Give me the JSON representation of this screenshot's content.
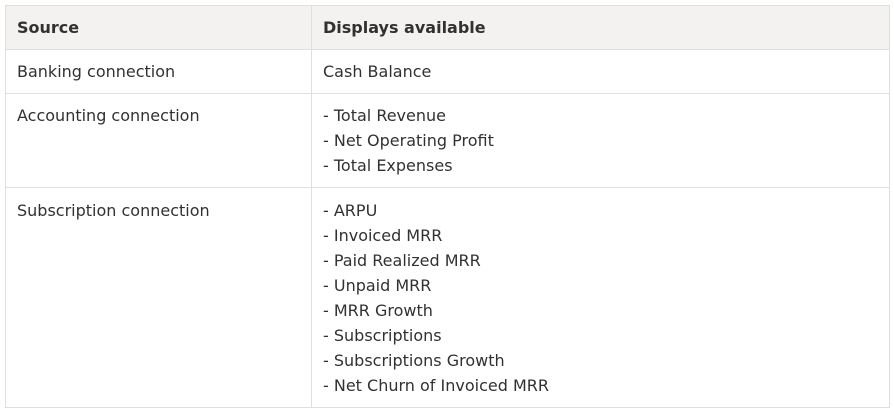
{
  "table": {
    "headers": [
      "Source",
      "Displays available"
    ],
    "rows": [
      {
        "source": "Banking connection",
        "displays": [
          "Cash Balance"
        ]
      },
      {
        "source": "Accounting connection",
        "displays": [
          "- Total Revenue",
          "- Net Operating Profit",
          "- Total Expenses"
        ]
      },
      {
        "source": "Subscription connection",
        "displays": [
          "- ARPU",
          "- Invoiced MRR",
          "- Paid Realized MRR",
          "- Unpaid MRR",
          "- MRR Growth",
          "- Subscriptions",
          "- Subscriptions Growth",
          "- Net Churn of Invoiced MRR"
        ]
      }
    ]
  },
  "colors": {
    "header_bg": "#f3f2f1",
    "border": "#e1dfdd",
    "text": "#323130"
  }
}
